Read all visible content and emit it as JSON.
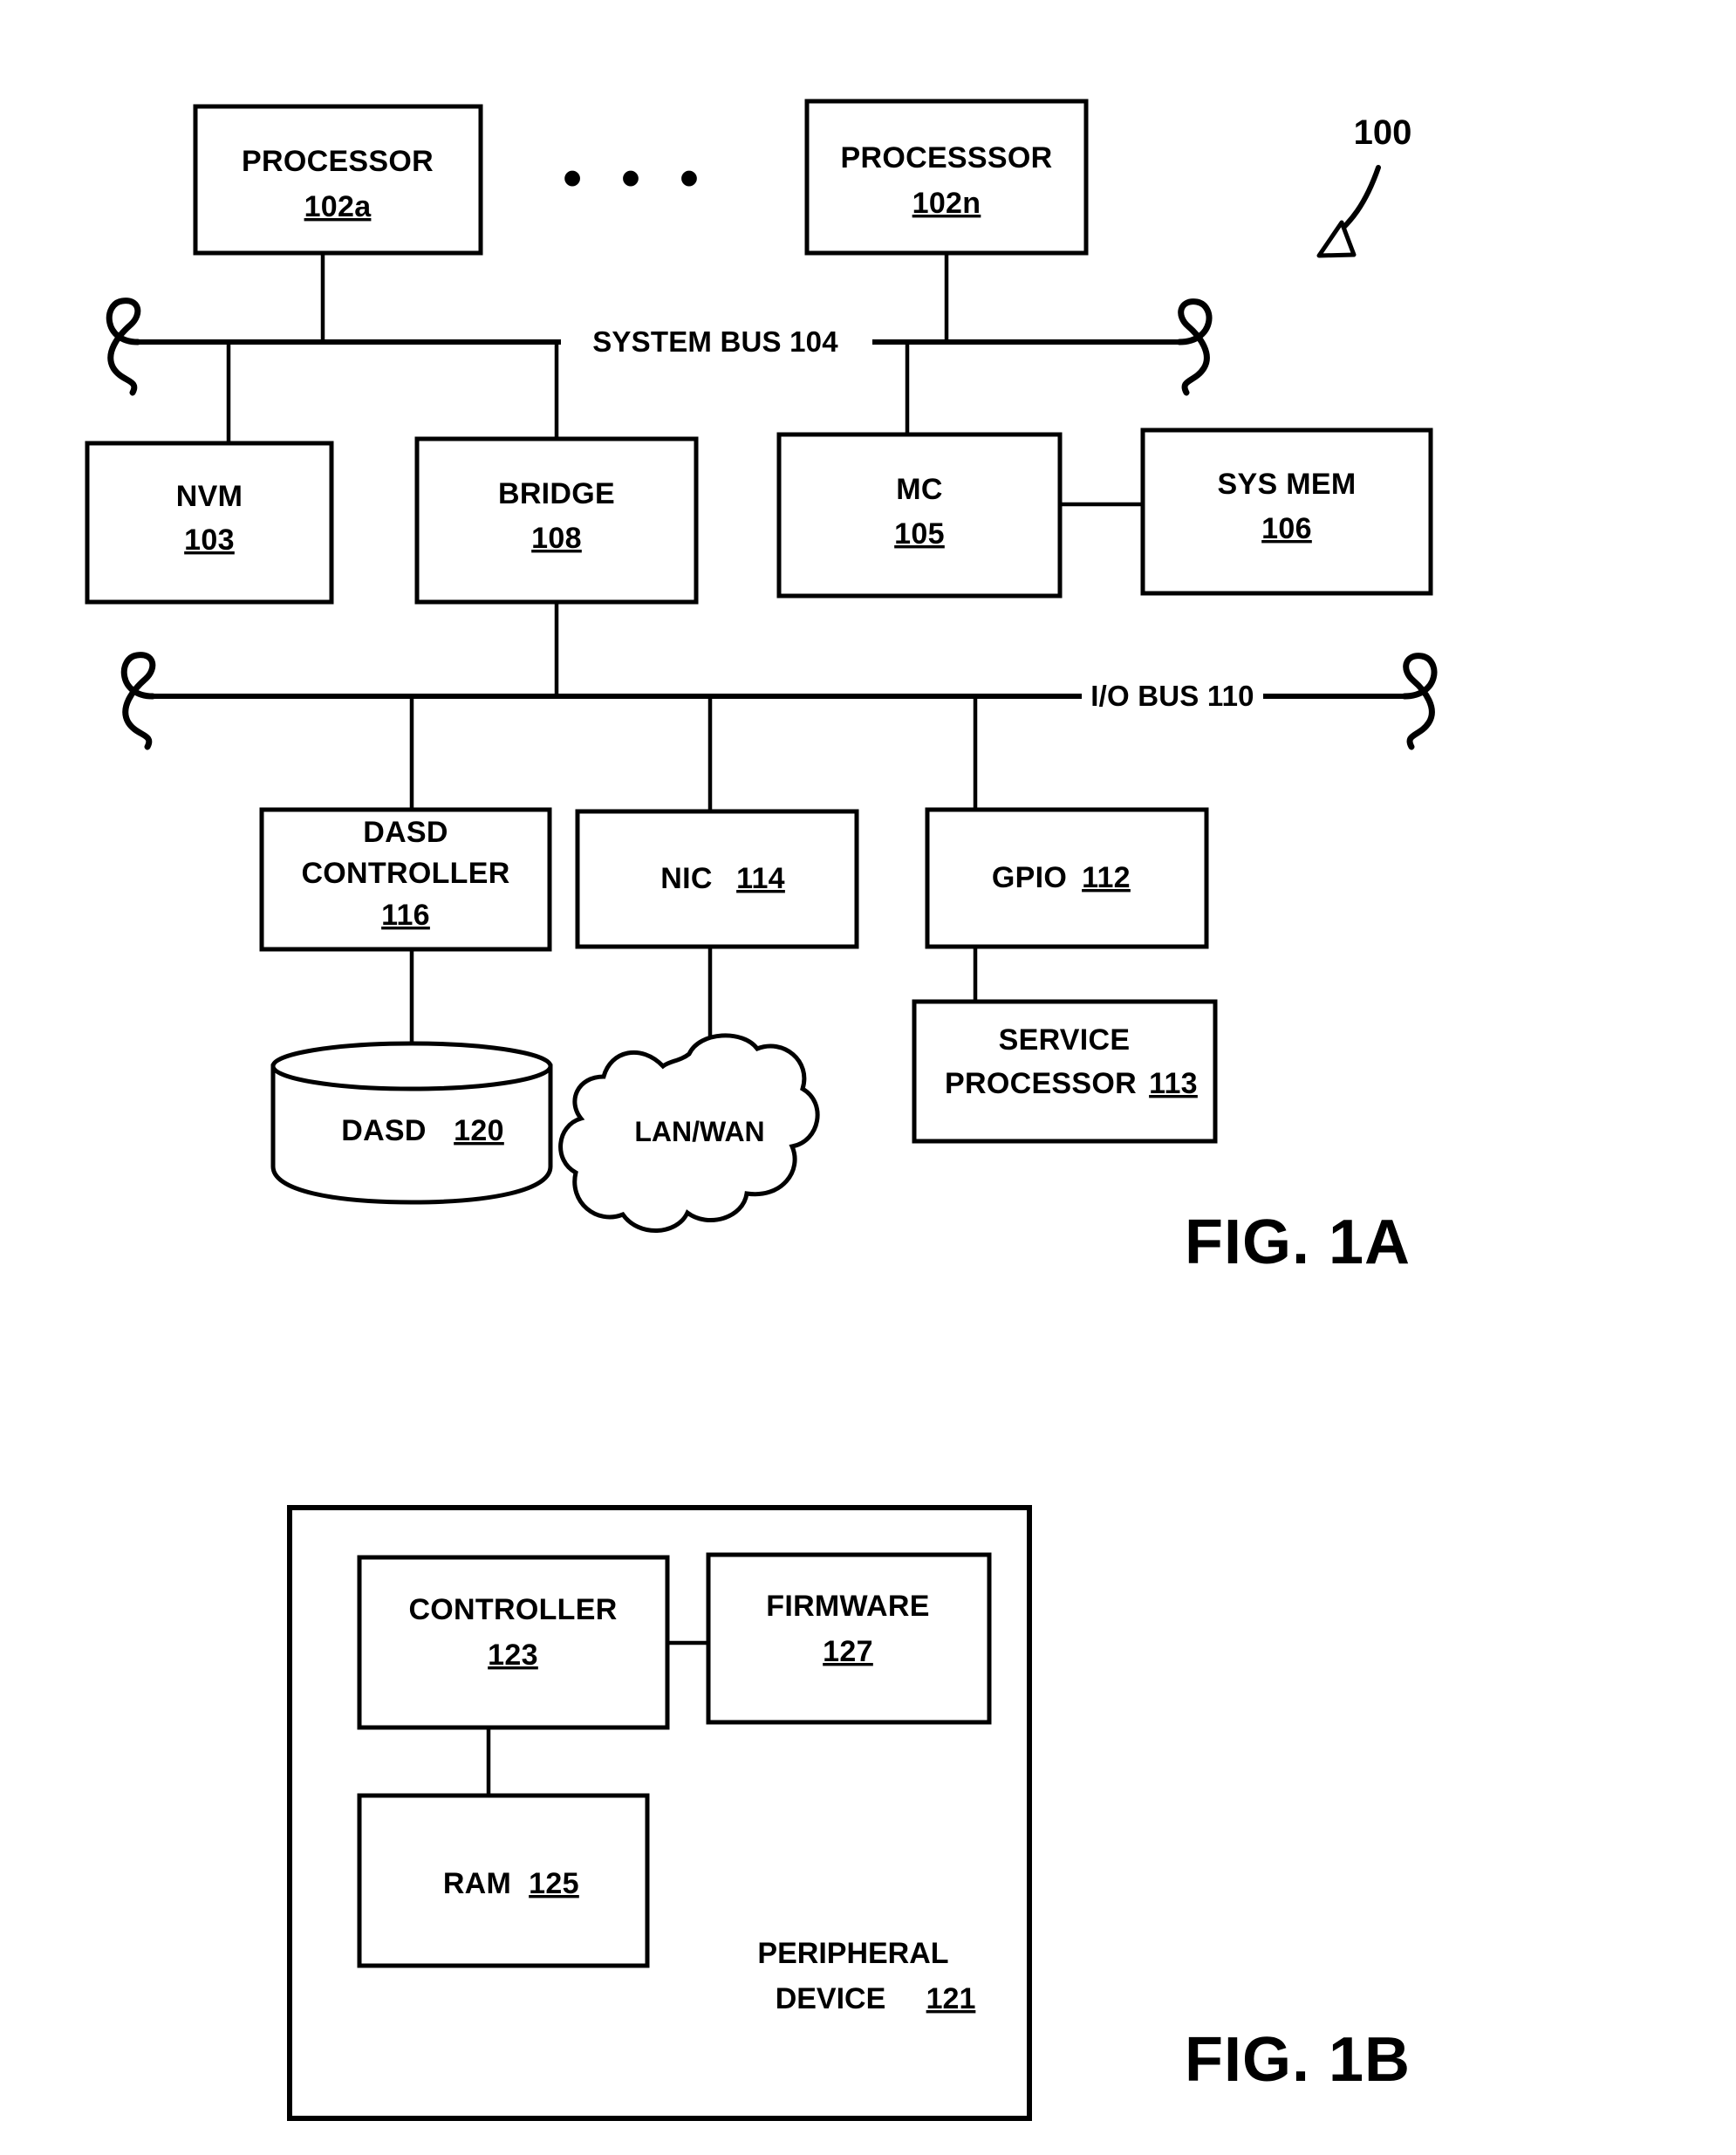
{
  "figure_1a": {
    "reference_label": "100",
    "caption": "FIG. 1A",
    "ellipsis": "• • •",
    "boxes": {
      "processor_a": {
        "line1": "PROCESSOR",
        "ref": "102a"
      },
      "processor_n": {
        "line1": "PROCESSSOR",
        "ref": "102n"
      },
      "nvm": {
        "line1": "NVM",
        "ref": "103"
      },
      "bridge": {
        "line1": "BRIDGE",
        "ref": "108"
      },
      "mc": {
        "line1": "MC",
        "ref": "105"
      },
      "sys_mem": {
        "line1": "SYS MEM",
        "ref": "106"
      },
      "dasd_controller": {
        "line1": "DASD",
        "line2": "CONTROLLER",
        "ref": "116"
      },
      "nic": {
        "line1": "NIC",
        "ref": "114"
      },
      "gpio": {
        "line1": "GPIO",
        "ref": "112"
      },
      "service_processor": {
        "line1": "SERVICE",
        "line2": "PROCESSOR",
        "ref": "113"
      },
      "dasd": {
        "line1": "DASD",
        "ref": "120"
      },
      "lan_wan": {
        "line1": "LAN/WAN"
      }
    },
    "buses": {
      "system_bus": "SYSTEM BUS 104",
      "io_bus": "I/O BUS 110"
    }
  },
  "figure_1b": {
    "caption": "FIG. 1B",
    "boxes": {
      "controller": {
        "line1": "CONTROLLER",
        "ref": "123"
      },
      "firmware": {
        "line1": "FIRMWARE",
        "ref": "127"
      },
      "ram": {
        "line1": "RAM",
        "ref": "125"
      },
      "peripheral_device": {
        "line1": "PERIPHERAL",
        "line2": "DEVICE",
        "ref": "121"
      }
    }
  },
  "colors": {
    "ink": "#000000",
    "paper": "#ffffff"
  }
}
